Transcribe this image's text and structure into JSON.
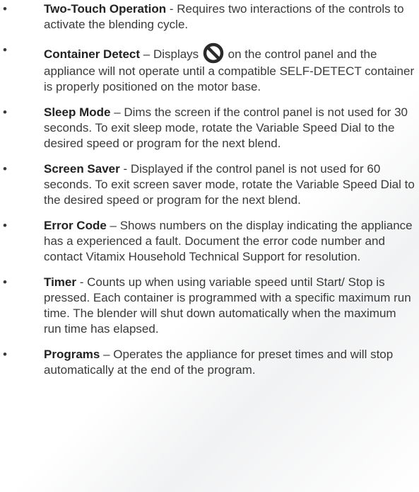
{
  "features": [
    {
      "term": "Two-Touch Operation",
      "separator": " - ",
      "text": "Requires two interactions of the controls to activate the blending cycle."
    },
    {
      "term": "Container Detect",
      "separator": " – ",
      "text_before": "Displays",
      "icon": "no-symbol-icon",
      "text_after": "on the control panel and the appliance will not operate until a compatible SELF-DETECT container is properly positioned on the motor base."
    },
    {
      "term": "Sleep Mode",
      "separator": " – ",
      "text": "Dims the screen if the control panel is not used for 30 seconds. To exit sleep mode, rotate the Variable Speed Dial to the desired speed or program for the next blend."
    },
    {
      "term": "Screen Saver",
      "separator": " - ",
      "text": "Displayed if the control panel is not used for 60 seconds. To exit screen saver mode, rotate the Variable Speed Dial to the desired speed or program for the next blend."
    },
    {
      "term": "Error Code",
      "separator": " – ",
      "text": "Shows numbers on the display indicating the appliance has a experienced a fault. Document the error code number and contact Vitamix Household Technical Support for resolution."
    },
    {
      "term": "Timer",
      "separator": " - ",
      "text": "Counts up when using variable speed until Start/ Stop is pressed. Each container is programmed with a specific maximum run time. The blender will shut down automatically when the maximum run time has elapsed."
    },
    {
      "term": "Programs",
      "separator": " – ",
      "text": "Operates the appliance for preset times and will stop automatically at the end of the program."
    }
  ],
  "bullet": "•"
}
